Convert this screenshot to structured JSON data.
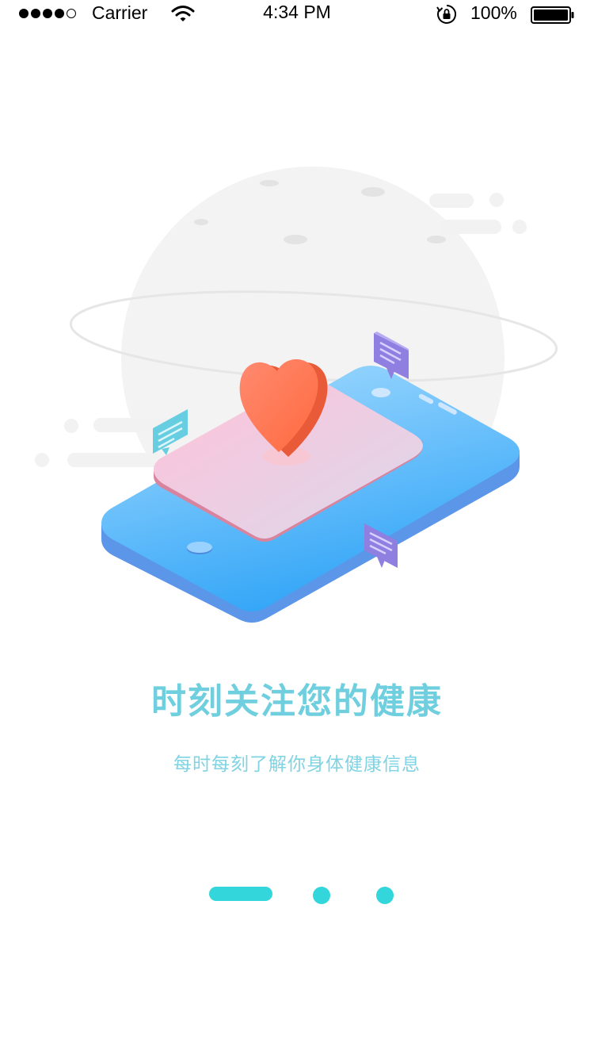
{
  "status_bar": {
    "carrier": "Carrier",
    "time": "4:34 PM",
    "battery_pct": "100%",
    "signal_bars_filled": 4,
    "signal_bars_total": 5
  },
  "onboarding": {
    "title": "时刻关注您的健康",
    "subtitle": "每时每刻了解你身体健康信息",
    "active_page": 1,
    "page_count": 3
  },
  "colors": {
    "title": "#6FCFDF",
    "subtitle": "#7FD3E2",
    "indicator": "#33D6DA",
    "phone_top": "#6BC6FB",
    "heart": "#FF7A55",
    "planet": "#F3F3F3"
  },
  "icons": {
    "wifi": "wifi-icon",
    "lock": "rotation-lock-icon",
    "battery": "battery-icon",
    "heart": "heart-icon",
    "chat": "chat-bubble-icon"
  }
}
